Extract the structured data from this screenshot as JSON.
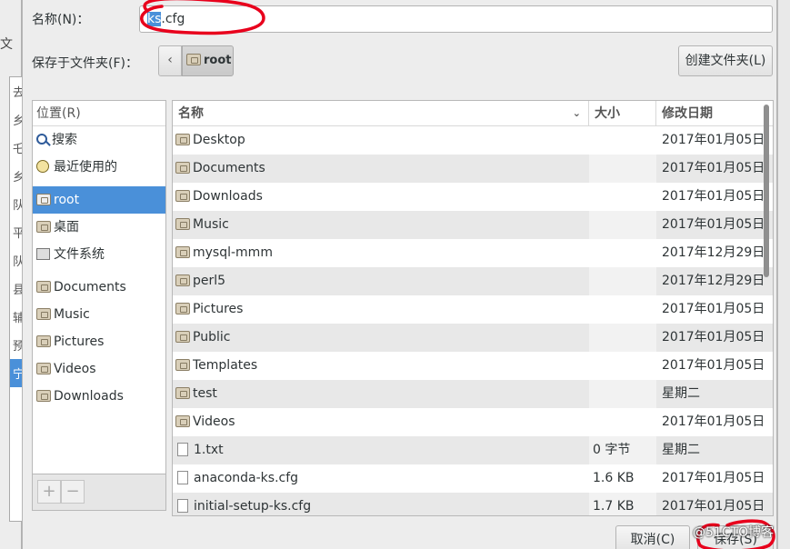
{
  "name_field": {
    "label": "名称(N)：",
    "value_selected": "ks",
    "value_rest": ".cfg"
  },
  "save_in": {
    "label": "保存于文件夹(F)：",
    "current": "root",
    "back_glyph": "‹"
  },
  "create_folder_label": "创建文件夹(L)",
  "places": {
    "header": "位置(R)",
    "items": [
      {
        "label": "搜索",
        "icon": "search-icon"
      },
      {
        "label": "最近使用的",
        "icon": "recent-icon"
      },
      {
        "label": "root",
        "icon": "home-folder-icon",
        "active": true
      },
      {
        "label": "桌面",
        "icon": "desktop-folder-icon"
      },
      {
        "label": "文件系统",
        "icon": "drive-icon"
      }
    ],
    "bookmarks": [
      {
        "label": "Documents",
        "icon": "folder-icon"
      },
      {
        "label": "Music",
        "icon": "folder-icon"
      },
      {
        "label": "Pictures",
        "icon": "folder-icon"
      },
      {
        "label": "Videos",
        "icon": "folder-icon"
      },
      {
        "label": "Downloads",
        "icon": "folder-icon"
      }
    ],
    "add_glyph": "+",
    "remove_glyph": "−"
  },
  "file_list": {
    "columns": {
      "name": "名称",
      "size": "大小",
      "modified": "修改日期",
      "sort_glyph": "⌄"
    },
    "rows": [
      {
        "name": "Desktop",
        "size": "",
        "modified": "2017年01月05日",
        "type": "folder"
      },
      {
        "name": "Documents",
        "size": "",
        "modified": "2017年01月05日",
        "type": "folder"
      },
      {
        "name": "Downloads",
        "size": "",
        "modified": "2017年01月05日",
        "type": "folder"
      },
      {
        "name": "Music",
        "size": "",
        "modified": "2017年01月05日",
        "type": "folder"
      },
      {
        "name": "mysql-mmm",
        "size": "",
        "modified": "2017年12月29日",
        "type": "folder"
      },
      {
        "name": "perl5",
        "size": "",
        "modified": "2017年12月29日",
        "type": "folder"
      },
      {
        "name": "Pictures",
        "size": "",
        "modified": "2017年01月05日",
        "type": "folder"
      },
      {
        "name": "Public",
        "size": "",
        "modified": "2017年01月05日",
        "type": "folder"
      },
      {
        "name": "Templates",
        "size": "",
        "modified": "2017年01月05日",
        "type": "folder"
      },
      {
        "name": "test",
        "size": "",
        "modified": "星期二",
        "type": "folder"
      },
      {
        "name": "Videos",
        "size": "",
        "modified": "2017年01月05日",
        "type": "folder"
      },
      {
        "name": "1.txt",
        "size": "0 字节",
        "modified": "星期二",
        "type": "file"
      },
      {
        "name": "anaconda-ks.cfg",
        "size": "1.6 KB",
        "modified": "2017年01月05日",
        "type": "file"
      },
      {
        "name": "initial-setup-ks.cfg",
        "size": "1.7 KB",
        "modified": "2017年01月05日",
        "type": "file"
      }
    ]
  },
  "buttons": {
    "cancel": "取消(C)",
    "save": "保存(S)"
  },
  "background_app": {
    "label": "文",
    "list": [
      "去",
      "乡",
      "乇",
      "乡",
      "队",
      "平",
      "队",
      "县",
      "辅",
      "预",
      "宁"
    ]
  },
  "watermark": "@51CTO博客",
  "colors": {
    "selection": "#4a90d9",
    "annotation": "#e8001c"
  }
}
